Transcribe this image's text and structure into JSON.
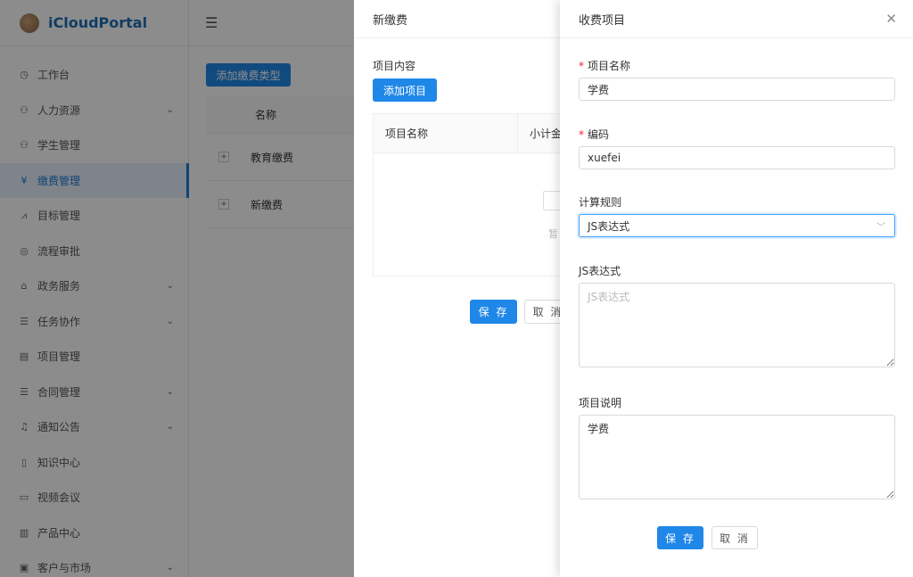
{
  "app": {
    "logo_text": "iCloudPortal"
  },
  "sidebar": {
    "items": [
      {
        "label": "工作台",
        "icon": "dashboard-icon",
        "glyph": "◷",
        "arrow": false,
        "active": false
      },
      {
        "label": "人力资源",
        "icon": "people-icon",
        "glyph": "⚇",
        "arrow": true,
        "active": false
      },
      {
        "label": "学生管理",
        "icon": "student-icon",
        "glyph": "⚇",
        "arrow": false,
        "active": false
      },
      {
        "label": "缴费管理",
        "icon": "yen-icon",
        "glyph": "¥",
        "arrow": false,
        "active": true
      },
      {
        "label": "目标管理",
        "icon": "chart-icon",
        "glyph": "⩘",
        "arrow": false,
        "active": false
      },
      {
        "label": "流程审批",
        "icon": "check-circle-icon",
        "glyph": "◎",
        "arrow": false,
        "active": false
      },
      {
        "label": "政务服务",
        "icon": "bank-icon",
        "glyph": "⌂",
        "arrow": true,
        "active": false
      },
      {
        "label": "任务协作",
        "icon": "list-icon",
        "glyph": "☰",
        "arrow": true,
        "active": false
      },
      {
        "label": "项目管理",
        "icon": "project-icon",
        "glyph": "▤",
        "arrow": false,
        "active": false
      },
      {
        "label": "合同管理",
        "icon": "contract-icon",
        "glyph": "☰",
        "arrow": true,
        "active": false
      },
      {
        "label": "通知公告",
        "icon": "bell-icon",
        "glyph": "♫",
        "arrow": true,
        "active": false
      },
      {
        "label": "知识中心",
        "icon": "book-icon",
        "glyph": "▯",
        "arrow": false,
        "active": false
      },
      {
        "label": "视频会议",
        "icon": "video-icon",
        "glyph": "▭",
        "arrow": false,
        "active": false
      },
      {
        "label": "产品中心",
        "icon": "barcode-icon",
        "glyph": "▥",
        "arrow": false,
        "active": false
      },
      {
        "label": "客户与市场",
        "icon": "customer-icon",
        "glyph": "▣",
        "arrow": true,
        "active": false
      }
    ]
  },
  "main": {
    "add_type_button": "添加缴费类型",
    "table": {
      "header": "名称",
      "rows": [
        {
          "expand": "+",
          "name": "教育缴费"
        },
        {
          "expand": "+",
          "name": "新缴费"
        }
      ]
    }
  },
  "drawer1": {
    "title": "新缴费",
    "content_label": "项目内容",
    "add_item_button": "添加项目",
    "table_headers": [
      "项目名称",
      "小计金"
    ],
    "empty_text": "暂",
    "save_button": "保 存",
    "cancel_button": "取 消"
  },
  "drawer2": {
    "title": "收费项目",
    "fields": {
      "name": {
        "label": "项目名称",
        "required_mark": "*",
        "value": "学费"
      },
      "code": {
        "label": "编码",
        "required_mark": "*",
        "value": "xuefei"
      },
      "rule": {
        "label": "计算规则",
        "value": "JS表达式"
      },
      "expression": {
        "label": "JS表达式",
        "placeholder": "JS表达式",
        "value": ""
      },
      "description": {
        "label": "项目说明",
        "value": "学费"
      }
    },
    "save_button": "保 存",
    "cancel_button": "取 消"
  },
  "colors": {
    "primary": "#1f87e8",
    "required": "#f5222d",
    "active_bg": "#e6f1fc"
  }
}
